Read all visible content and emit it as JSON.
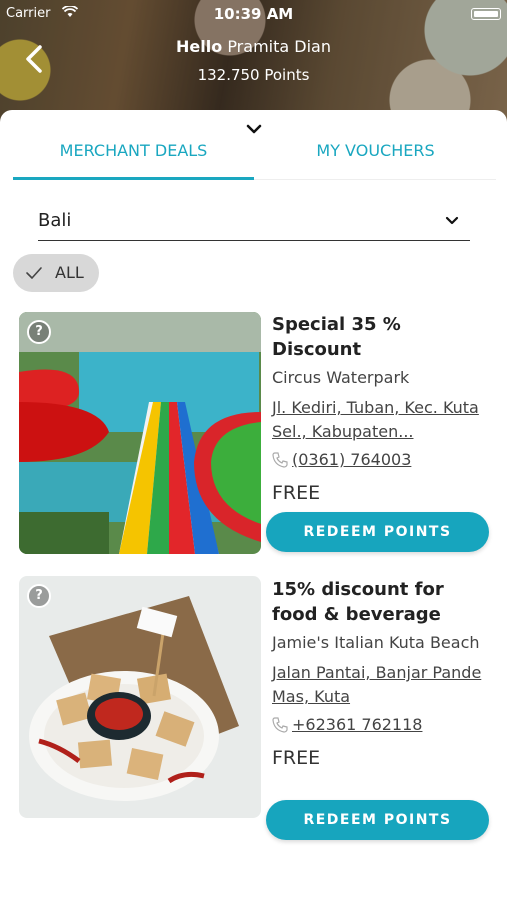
{
  "status_bar": {
    "carrier": "Carrier",
    "time": "10:39 AM"
  },
  "header": {
    "hello_label": "Hello",
    "user_name": "Pramita Dian",
    "points": "132.750 Points"
  },
  "tabs": [
    {
      "label": "MERCHANT DEALS",
      "active": true
    },
    {
      "label": "MY VOUCHERS",
      "active": false
    }
  ],
  "location": {
    "selected": "Bali"
  },
  "filter": {
    "label": "ALL"
  },
  "deals": [
    {
      "title": "Special 35 % Discount",
      "merchant": "Circus Waterpark",
      "address": "Jl. Kediri, Tuban, Kec. Kuta Sel., Kabupaten...",
      "phone": "(0361) 764003",
      "price": "FREE",
      "button": "REDEEM POINTS"
    },
    {
      "title": "15% discount for food & beverage",
      "merchant": "Jamie's Italian Kuta Beach",
      "address": "Jalan Pantai, Banjar Pande Mas, Kuta",
      "phone": "+62361 762118",
      "price": "FREE",
      "button": "REDEEM POINTS"
    }
  ],
  "colors": {
    "accent": "#17a5be",
    "chip_bg": "#d8d8d8"
  }
}
